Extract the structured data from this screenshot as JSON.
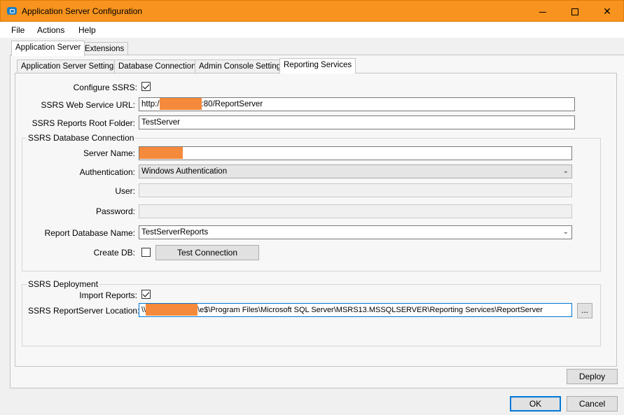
{
  "window": {
    "title": "Application Server Configuration",
    "minimize_icon": "minimize-icon",
    "maximize_icon": "maximize-icon",
    "close_icon": "close-icon",
    "close_glyph": "✕",
    "title_bar_color": "#f7931e"
  },
  "menu": {
    "file": "File",
    "actions": "Actions",
    "help": "Help"
  },
  "outer_tabs": {
    "application_server": "Application Server",
    "extensions": "Extensions"
  },
  "inner_tabs": {
    "settings": "Application Server Settings",
    "database": "Database Connection",
    "admin": "Admin Console Settings",
    "reporting": "Reporting Services"
  },
  "form": {
    "configure_ssrs_label": "Configure SSRS:",
    "configure_ssrs_checked": true,
    "web_service_url_label": "SSRS Web Service URL:",
    "web_service_url_prefix": "http:/",
    "web_service_url_suffix": ":80/ReportServer",
    "root_folder_label": "SSRS Reports Root Folder:",
    "root_folder_value": "TestServer"
  },
  "db_group": {
    "title": "SSRS Database Connection",
    "server_name_label": "Server Name:",
    "authentication_label": "Authentication:",
    "authentication_value": "Windows Authentication",
    "user_label": "User:",
    "password_label": "Password:",
    "report_db_label": "Report Database Name:",
    "report_db_value": "TestServerReports",
    "create_db_label": "Create DB:",
    "create_db_checked": false,
    "test_connection": "Test Connection",
    "dropdown_glyph": "⌄"
  },
  "deploy_group": {
    "title": "SSRS Deployment",
    "import_reports_label": "Import Reports:",
    "import_reports_checked": true,
    "location_label": "SSRS ReportServer Location:",
    "location_prefix": "\\\\",
    "location_suffix": "\\e$\\Program Files\\Microsoft SQL Server\\MSRS13.MSSQLSERVER\\Reporting Services\\ReportServer",
    "browse": "..."
  },
  "buttons": {
    "deploy": "Deploy",
    "ok": "OK",
    "cancel": "Cancel"
  },
  "colors": {
    "redaction": "#f58a3c",
    "focus": "#0078d7"
  }
}
